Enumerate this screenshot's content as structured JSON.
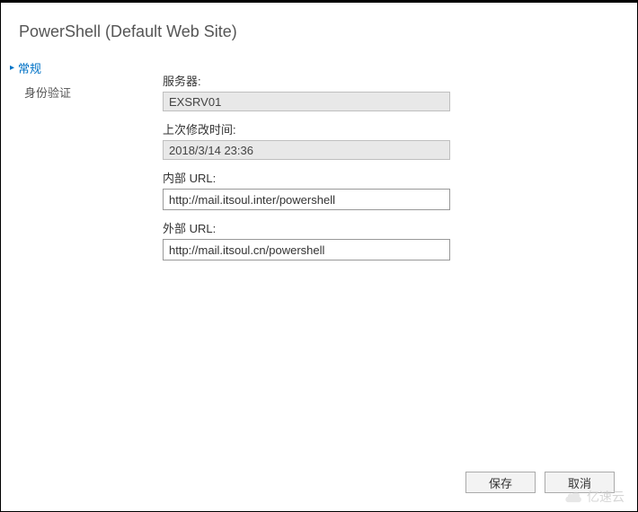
{
  "header": {
    "title": "PowerShell (Default Web Site)"
  },
  "sidebar": {
    "general": "常规",
    "authentication": "身份验证"
  },
  "form": {
    "server_label": "服务器:",
    "server_value": "EXSRV01",
    "last_modified_label": "上次修改时间:",
    "last_modified_value": "2018/3/14 23:36",
    "internal_url_label": "内部 URL:",
    "internal_url_value": "http://mail.itsoul.inter/powershell",
    "external_url_label": "外部 URL:",
    "external_url_value": "http://mail.itsoul.cn/powershell"
  },
  "buttons": {
    "save": "保存",
    "cancel": "取消"
  },
  "watermark": {
    "text": "亿速云"
  }
}
